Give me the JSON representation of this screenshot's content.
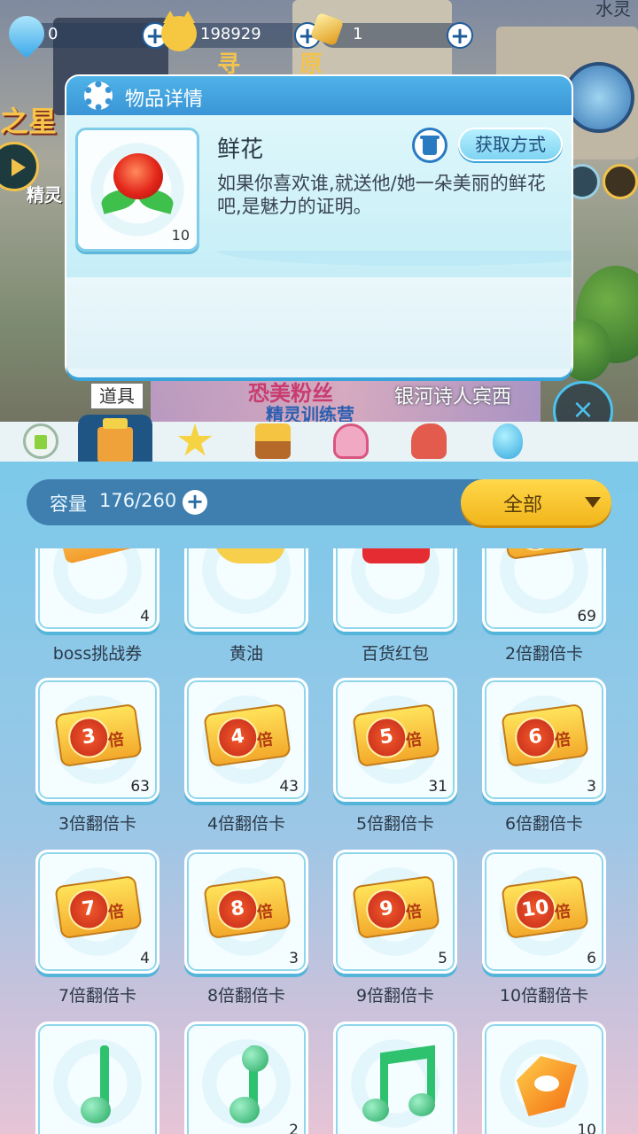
{
  "resources": [
    {
      "icon": "diamond-icon",
      "value": "0"
    },
    {
      "icon": "cat-coin-icon",
      "value": "198929"
    },
    {
      "icon": "gold-ingot-icon",
      "value": "1"
    }
  ],
  "scene": {
    "left_banner": "之星",
    "left_sub": "精灵",
    "mid_text_1": "寻",
    "mid_text_2": "原",
    "top_right": "水灵",
    "npc_name": "银河诗人宾西",
    "banner_line_1": "恐美粉丝",
    "banner_line_2": "精灵训练营"
  },
  "popup": {
    "title": "物品详情",
    "item_name": "鲜花",
    "item_description": "如果你喜欢谁,就送他/她一朵美丽的鲜花吧,是魅力的证明。",
    "item_count": "10",
    "obtain_button": "获取方式"
  },
  "tabs": {
    "tooltip": "道具",
    "items": [
      {
        "icon": "battery-icon"
      },
      {
        "icon": "item-box-icon",
        "active": true
      },
      {
        "icon": "star-wand-icon"
      },
      {
        "icon": "trophy-icon"
      },
      {
        "icon": "dress-icon"
      },
      {
        "icon": "rocking-horse-icon"
      },
      {
        "icon": "egg-icon"
      }
    ]
  },
  "bag": {
    "capacity_label": "容量",
    "capacity_value": "176/260",
    "filter_label": "全部",
    "items": [
      {
        "name": "boss挑战券",
        "count": "4",
        "icon": "boss-challenge-ticket-icon"
      },
      {
        "name": "黄油",
        "count": "",
        "icon": "butter-icon"
      },
      {
        "name": "百货红包",
        "count": "",
        "icon": "red-envelope-icon"
      },
      {
        "name": "2倍翻倍卡",
        "count": "69",
        "icon": "double-card-icon",
        "mult": "2"
      },
      {
        "name": "3倍翻倍卡",
        "count": "63",
        "icon": "multiplier-card-icon",
        "mult": "3"
      },
      {
        "name": "4倍翻倍卡",
        "count": "43",
        "icon": "multiplier-card-icon",
        "mult": "4"
      },
      {
        "name": "5倍翻倍卡",
        "count": "31",
        "icon": "multiplier-card-icon",
        "mult": "5"
      },
      {
        "name": "6倍翻倍卡",
        "count": "3",
        "icon": "multiplier-card-icon",
        "mult": "6"
      },
      {
        "name": "7倍翻倍卡",
        "count": "4",
        "icon": "multiplier-card-icon",
        "mult": "7"
      },
      {
        "name": "8倍翻倍卡",
        "count": "3",
        "icon": "multiplier-card-icon",
        "mult": "8"
      },
      {
        "name": "9倍翻倍卡",
        "count": "5",
        "icon": "multiplier-card-icon",
        "mult": "9"
      },
      {
        "name": "10倍翻倍卡",
        "count": "6",
        "icon": "multiplier-card-icon",
        "mult": "10"
      },
      {
        "name": "",
        "count": "",
        "icon": "music-note-icon"
      },
      {
        "name": "",
        "count": "2",
        "icon": "music-note-icon"
      },
      {
        "name": "",
        "count": "",
        "icon": "double-music-note-icon"
      },
      {
        "name": "",
        "count": "10",
        "icon": "eye-crystal-icon"
      }
    ]
  },
  "card_suffix": "倍"
}
